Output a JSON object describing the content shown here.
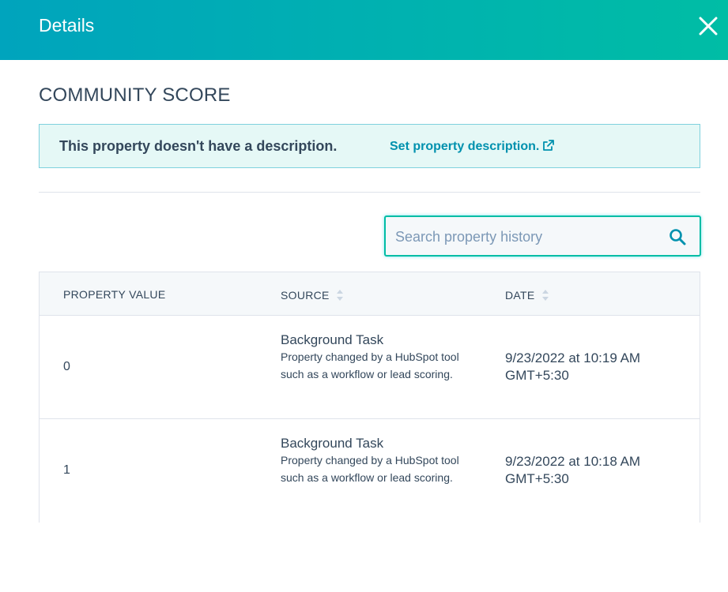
{
  "header": {
    "title": "Details",
    "close_icon": "close-icon"
  },
  "property": {
    "name": "COMMUNITY SCORE"
  },
  "description": {
    "text": "This property doesn't have a description.",
    "link_label": "Set property description.",
    "link_icon": "external-link-icon"
  },
  "search": {
    "value": "",
    "placeholder": "Search property history",
    "icon": "search-icon"
  },
  "table": {
    "columns": [
      "PROPERTY VALUE",
      "SOURCE",
      "DATE"
    ],
    "rows": [
      {
        "value": "0",
        "source_name": "Background Task",
        "source_desc": "Property changed by a HubSpot tool such as a workflow or lead scoring.",
        "date": "9/23/2022 at 10:19 AM GMT+5:30"
      },
      {
        "value": "1",
        "source_name": "Background Task",
        "source_desc": "Property changed by a HubSpot tool such as a workflow or lead scoring.",
        "date": "9/23/2022 at 10:18 AM GMT+5:30"
      }
    ]
  },
  "colors": {
    "header_gradient_start": "#00a4bd",
    "header_gradient_end": "#00bda5",
    "link": "#0091ae",
    "text": "#33475b"
  }
}
